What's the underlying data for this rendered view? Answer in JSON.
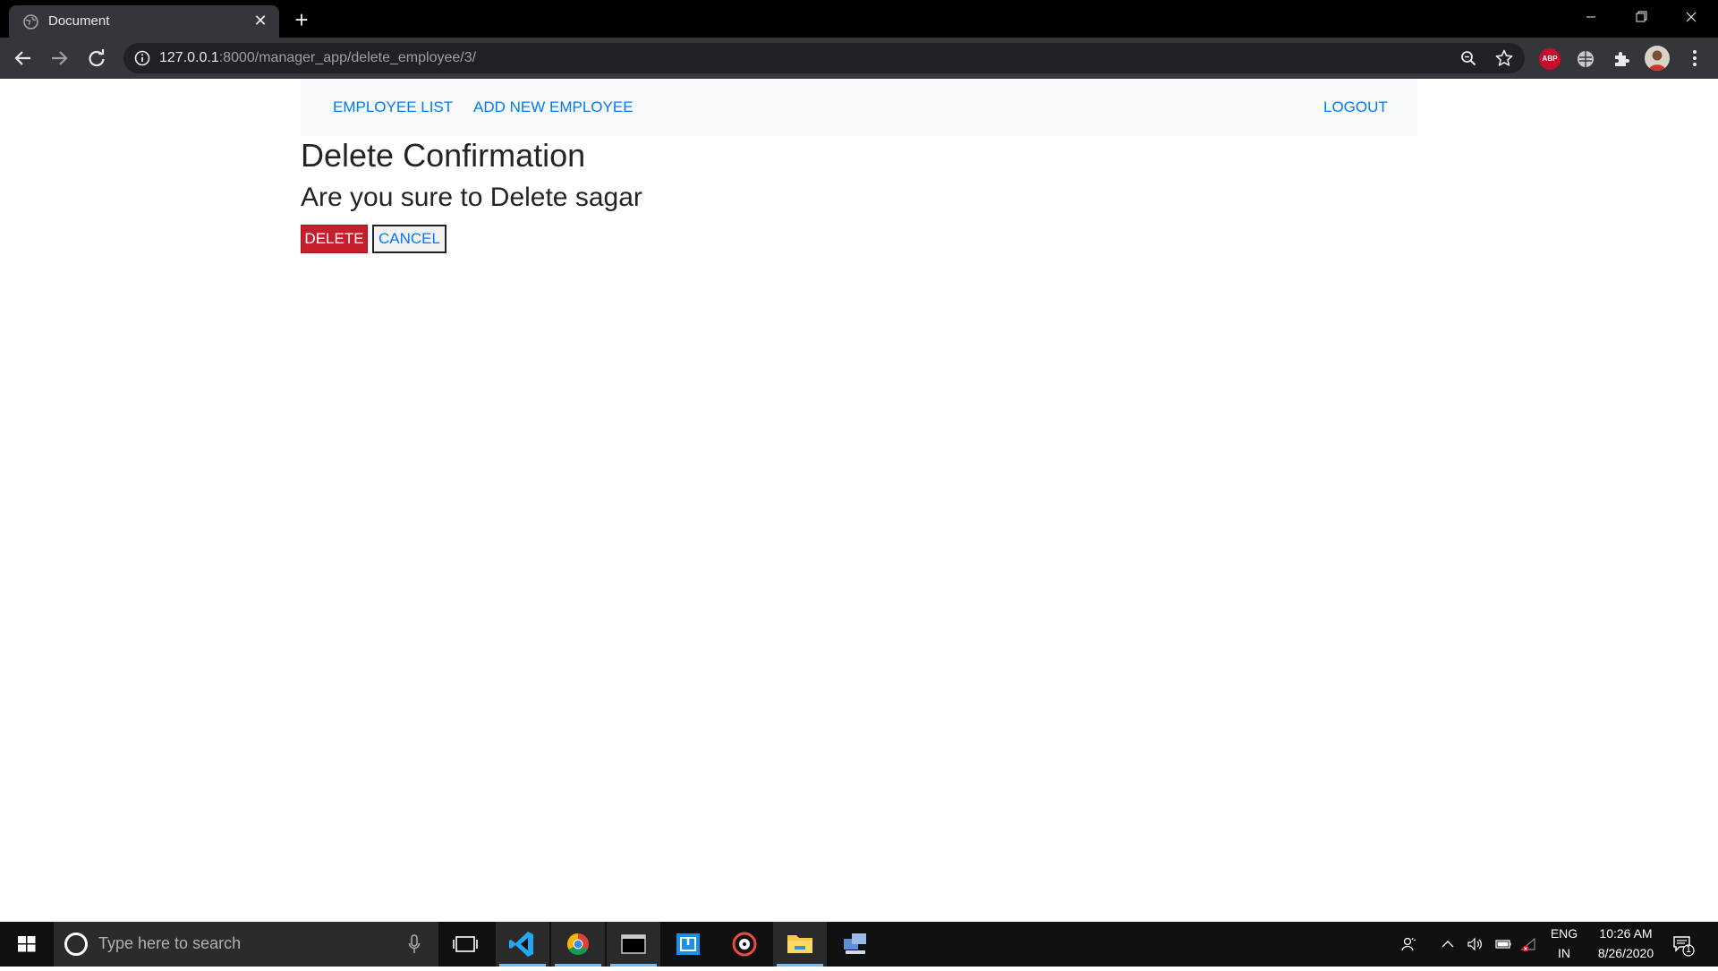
{
  "browser": {
    "tab_title": "Document",
    "url_host": "127.0.0.1",
    "url_rest": ":8000/manager_app/delete_employee/3/",
    "extension_abp": "ABP"
  },
  "navbar": {
    "employee_list": "EMPLOYEE LIST",
    "add_new_employee": "ADD NEW EMPLOYEE",
    "logout": "LOGOUT"
  },
  "page": {
    "title": "Delete Confirmation",
    "question": "Are you sure to Delete sagar",
    "delete_label": "DELETE",
    "cancel_label": "CANCEL"
  },
  "taskbar": {
    "search_placeholder": "Type here to search",
    "language_top": "ENG",
    "language_bottom": "IN",
    "time": "10:26 AM",
    "date": "8/26/2020",
    "notification_count": "1"
  },
  "colors": {
    "link": "#007bff",
    "danger": "#c51f2e",
    "navbar_bg": "#f8f9fa"
  }
}
